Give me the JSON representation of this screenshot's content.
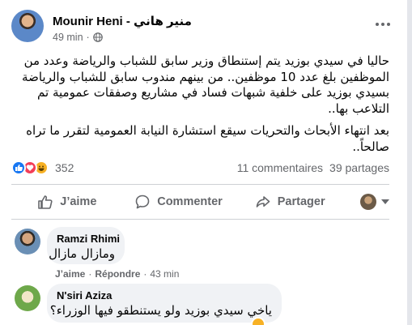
{
  "post": {
    "author": "Mounir Heni - منير هاني",
    "time": "49 min",
    "separator": "·",
    "privacy_icon": "globe-icon",
    "more_icon": "more-horizontal-icon",
    "paragraphs": [
      "حاليا في سيدي بوزيد يتم إستنطاق وزير سابق للشباب والرياضة وعدد من الموظفين بلغ عدد 10 موظفين.. من بينهم مندوب سابق للشباب والرياضة بسيدي بوزيد على خلفية شبهات فساد في مشاريع وصفقات عمومية تم التلاعب بها..",
      "بعد انتهاء الأبحاث والتحريات سيقع استشارة النيابة العمومية لتقرر ما تراه صالحاً.."
    ],
    "reactions": {
      "icons": [
        "like-icon",
        "love-icon",
        "haha-icon"
      ],
      "count": "352"
    },
    "comments_count": "11 commentaires",
    "shares_count": "39 partages"
  },
  "actions": {
    "like_label": "J’aime",
    "comment_label": "Commenter",
    "share_label": "Partager"
  },
  "comments": [
    {
      "name": "Ramzi Rhimi",
      "text": "ومازال مازال",
      "like_label": "J’aime",
      "reply_label": "Répondre",
      "separator": "·",
      "time": "43 min"
    },
    {
      "name": "N'siri Aziza",
      "text": "ياخي سيدي بوزيد ولو يستنطقو فيها الوزراء؟"
    }
  ],
  "colors": {
    "accent": "#1877f2",
    "secondary_text": "#65676b",
    "comment_bg": "#f0f2f5",
    "divider": "#ced0d4"
  }
}
